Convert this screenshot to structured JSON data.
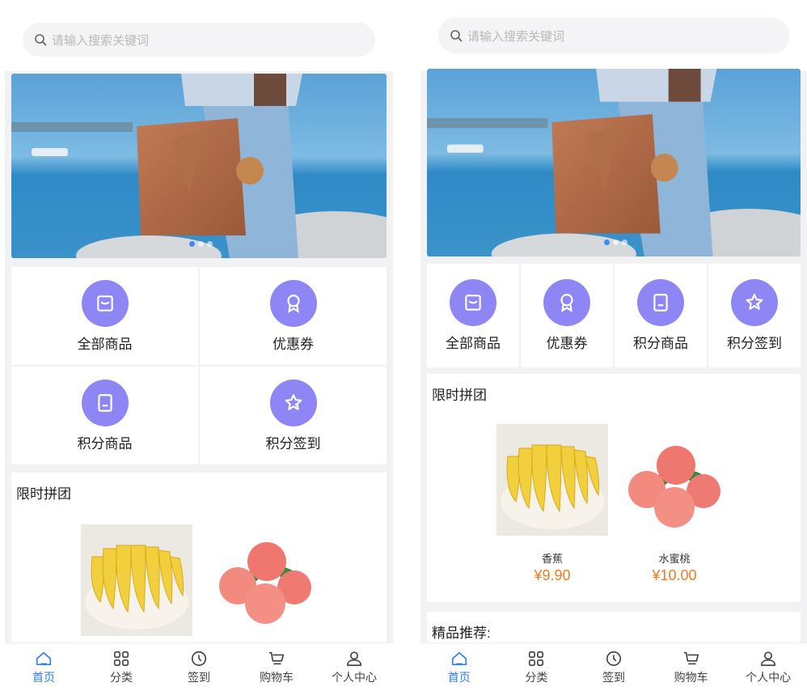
{
  "search": {
    "placeholder": "请输入搜索关键词"
  },
  "menu": [
    {
      "label": "全部商品",
      "icon": "bag-icon"
    },
    {
      "label": "优惠券",
      "icon": "badge-icon"
    },
    {
      "label": "积分商品",
      "icon": "book-icon"
    },
    {
      "label": "积分签到",
      "icon": "star-check-icon"
    }
  ],
  "group_buy": {
    "title": "限时拼团",
    "products": [
      {
        "name": "香蕉",
        "price": "¥9.90"
      },
      {
        "name": "水蜜桃",
        "price": "¥10.00"
      }
    ]
  },
  "recommend": {
    "title": "精品推荐:"
  },
  "tabs": [
    {
      "label": "首页",
      "icon": "home-icon",
      "active": true
    },
    {
      "label": "分类",
      "icon": "grid-icon",
      "active": false
    },
    {
      "label": "签到",
      "icon": "clock-icon",
      "active": false
    },
    {
      "label": "购物车",
      "icon": "cart-icon",
      "active": false
    },
    {
      "label": "个人中心",
      "icon": "user-icon",
      "active": false
    }
  ],
  "colors": {
    "accent": "#2f7fe8",
    "icon_bg": "#8f86f5",
    "price": "#f27c1c"
  }
}
